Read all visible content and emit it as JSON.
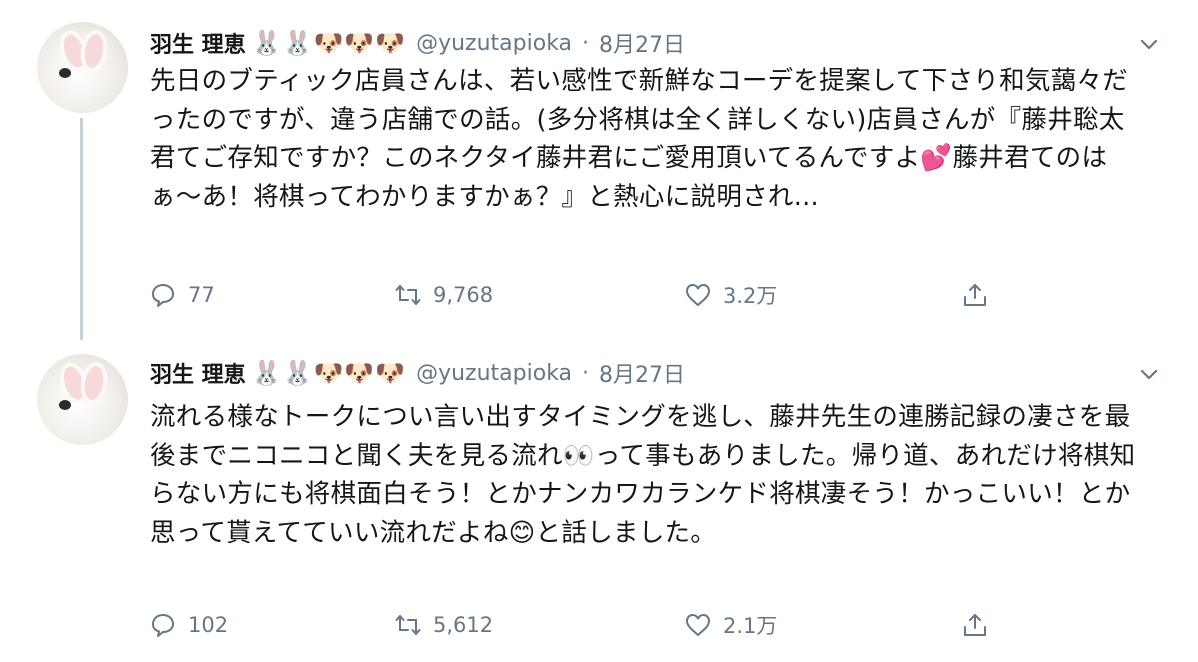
{
  "tweets": [
    {
      "display_name": "羽生 理恵",
      "name_emojis": "🐰🐰🐶🐶🐶",
      "handle": "@yuzutapioka",
      "separator": "·",
      "date": "8月27日",
      "text": "先日のブティック店員さんは、若い感性で新鮮なコーデを提案して下さり和気藹々だったのですが、違う店舗での話。(多分将棋は全く詳しくない)店員さんが『藤井聡太君てご存知ですか？このネクタイ藤井君にご愛用頂いてるんですよ💕藤井君てのはぁ〜あ！将棋ってわかりますかぁ？』と熱心に説明され...",
      "reply_count": "77",
      "retweet_count": "9,768",
      "like_count": "3.2万"
    },
    {
      "display_name": "羽生 理恵",
      "name_emojis": "🐰🐰🐶🐶🐶",
      "handle": "@yuzutapioka",
      "separator": "·",
      "date": "8月27日",
      "text": "流れる様なトークについ言い出すタイミングを逃し、藤井先生の連勝記録の凄さを最後までニコニコと聞く夫を見る流れ👀って事もありました。帰り道、あれだけ将棋知らない方にも将棋面白そう！とかナンカワカランケド将棋凄そう！かっこいい！とか思って貰えてていい流れだよね😊と話しました。",
      "reply_count": "102",
      "retweet_count": "5,612",
      "like_count": "2.1万"
    }
  ],
  "icons": {
    "reply": "speech-bubble-icon",
    "retweet": "retweet-arrows-icon",
    "like": "heart-icon",
    "share": "share-upload-icon",
    "more": "chevron-down-icon"
  },
  "colors": {
    "text": "#14171a",
    "secondary": "#657786",
    "thread_line": "#c4cfd6"
  }
}
